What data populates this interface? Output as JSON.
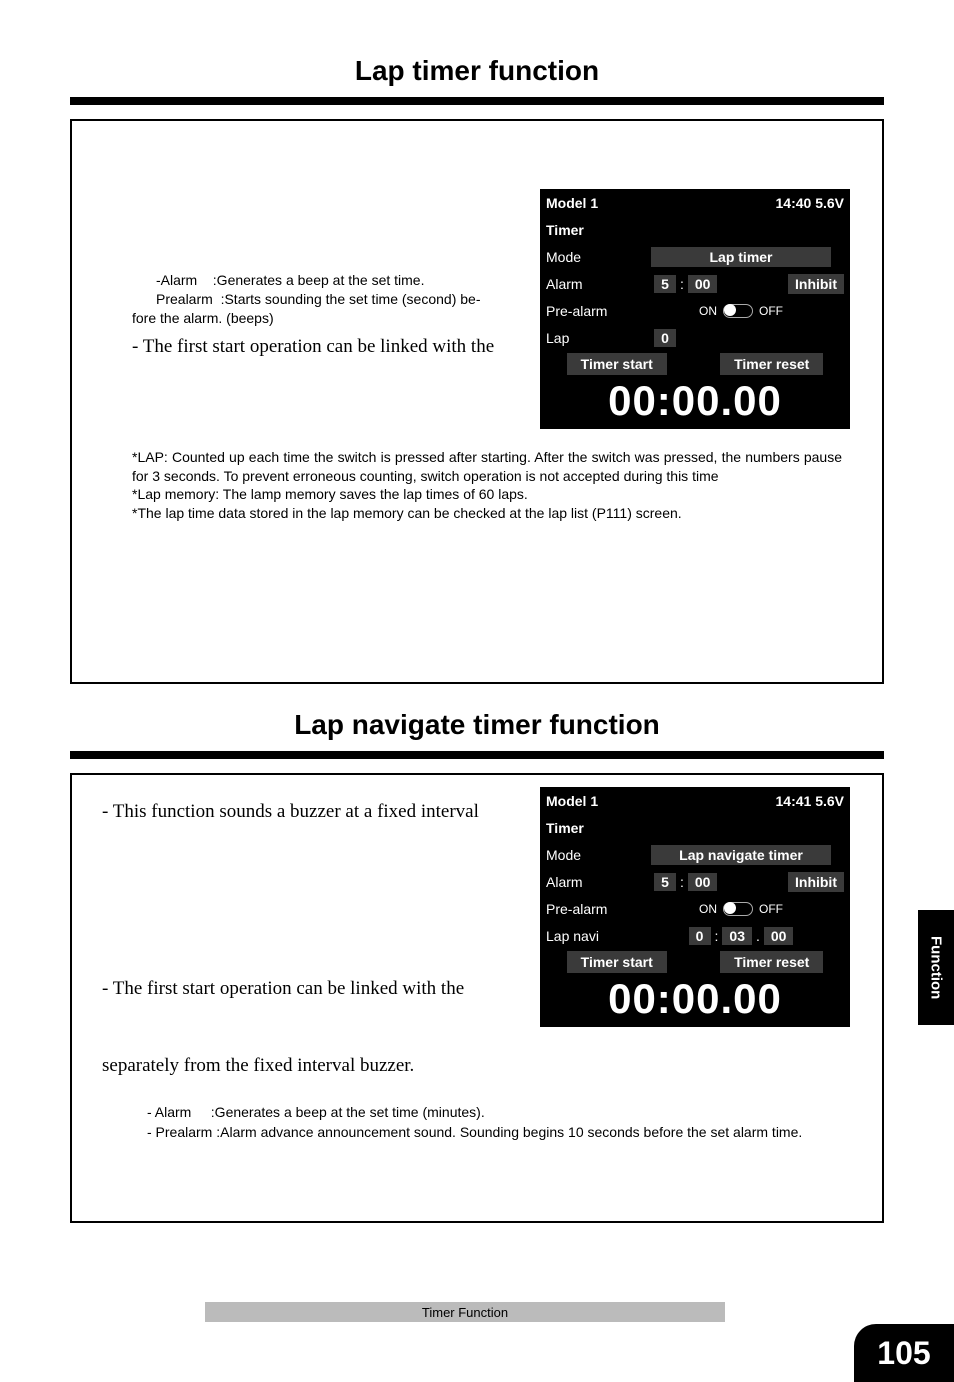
{
  "page": {
    "title1": "Lap timer function",
    "title2": "Lap navigate timer function",
    "footer": "Timer Function",
    "side_tab": "Function",
    "page_number": "105"
  },
  "section1": {
    "desc_alarm_label": "-Alarm",
    "desc_alarm_text": ":Generates a beep at the set time.",
    "desc_prealarm_label": "Prealarm",
    "desc_prealarm_text": ":Starts sounding the set time (second) be-",
    "desc_prealarm_cont": "fore the alarm. (beeps)",
    "body1": "- The first start operation can be linked with the",
    "note1": "*LAP: Counted up each time the switch is pressed after starting. After the switch was pressed, the numbers pause for 3 seconds. To prevent erroneous counting, switch operation is not accepted during this time",
    "note2": "*Lap memory: The lamp memory saves the lap times of 60 laps.",
    "note3": "*The lap time data stored in the lap memory can be checked at the lap list (P111) screen."
  },
  "lcd1": {
    "model": "Model 1",
    "status": "14:40 5.6V",
    "screen_title": "Timer",
    "row_mode_label": "Mode",
    "row_mode_value": "Lap timer",
    "row_alarm_label": "Alarm",
    "alarm_min": "5",
    "alarm_sep": ":",
    "alarm_sec": "00",
    "inhibit": "Inhibit",
    "row_prealarm_label": "Pre-alarm",
    "toggle_on": "ON",
    "toggle_off": "OFF",
    "row_lap_label": "Lap",
    "lap_value": "0",
    "action_start": "Timer start",
    "action_reset": "Timer reset",
    "big_time": "00:00.00"
  },
  "section2": {
    "body1": "- This function sounds a buzzer at a fixed interval",
    "body2": "- The first start operation can be linked with the",
    "body3": "separately from the fixed interval buzzer.",
    "note_alarm_label": "- Alarm",
    "note_alarm_text": ":Generates a beep at the set time (minutes).",
    "note_prealarm": "- Prealarm :Alarm advance announcement sound. Sounding begins 10 seconds before the set alarm time."
  },
  "lcd2": {
    "model": "Model 1",
    "status": "14:41 5.6V",
    "screen_title": "Timer",
    "row_mode_label": "Mode",
    "row_mode_value": "Lap navigate timer",
    "row_alarm_label": "Alarm",
    "alarm_min": "5",
    "alarm_sep": ":",
    "alarm_sec": "00",
    "inhibit": "Inhibit",
    "row_prealarm_label": "Pre-alarm",
    "toggle_on": "ON",
    "toggle_off": "OFF",
    "row_lapnavi_label": "Lap navi",
    "navi_a": "0",
    "navi_sep1": ":",
    "navi_b": "03",
    "navi_sep2": ".",
    "navi_c": "00",
    "action_start": "Timer start",
    "action_reset": "Timer reset",
    "big_time": "00:00.00"
  }
}
